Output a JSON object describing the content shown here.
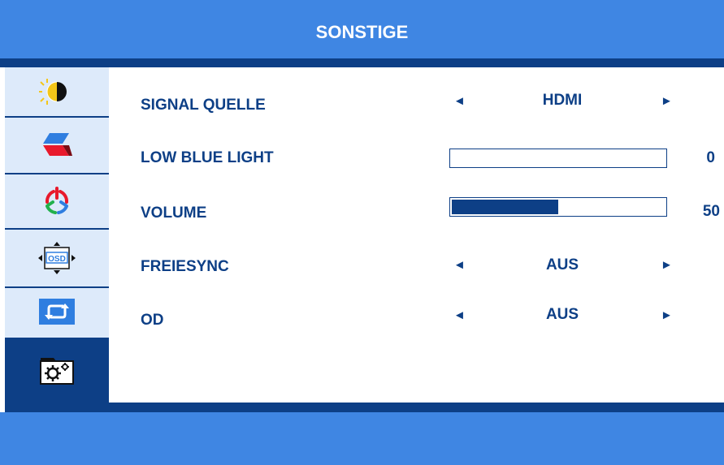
{
  "header": {
    "title": "SONSTIGE"
  },
  "sidebar": {
    "items": [
      {
        "icon": "brightness-contrast-icon",
        "active": false
      },
      {
        "icon": "image-settings-icon",
        "active": false
      },
      {
        "icon": "color-settings-icon",
        "active": false
      },
      {
        "icon": "osd-settings-icon",
        "active": false
      },
      {
        "icon": "reset-icon",
        "active": false
      },
      {
        "icon": "other-settings-icon",
        "active": true
      }
    ]
  },
  "settings": {
    "signal_source": {
      "label": "SIGNAL QUELLE",
      "value": "HDMI",
      "left_arrow": "◄",
      "right_arrow": "►"
    },
    "low_blue_light": {
      "label": "LOW BLUE LIGHT",
      "value": "0",
      "level_percent": 0
    },
    "volume": {
      "label": "VOLUME",
      "value": "50",
      "level_percent": 50
    },
    "freesync": {
      "label": "FREIESYNC",
      "value": "AUS",
      "left_arrow": "◄",
      "right_arrow": "►"
    },
    "od": {
      "label": "OD",
      "value": "AUS",
      "left_arrow": "◄",
      "right_arrow": "►"
    }
  },
  "colors": {
    "dark_blue": "#0d3f86",
    "light_blue": "#3f86e3",
    "sidebar_bg": "#ddeafa"
  }
}
